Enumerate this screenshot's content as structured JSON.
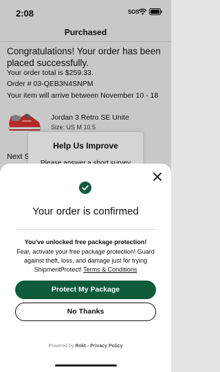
{
  "status_bar": {
    "time": "2:08",
    "sos": "SOS"
  },
  "header": {
    "title": "Purchased"
  },
  "order": {
    "congrats": "Congratulations!  Your order has been placed successfully.",
    "total_line": "Your order total is $259.33.",
    "order_number_line": "Order # 03-QEB3N4SNPM",
    "arrival_line": "Your item will arrive between  November 10 - 18"
  },
  "product": {
    "name": "Jordan 3 Retro SE Unite",
    "size": "Size: US M 10.5"
  },
  "next_section": {
    "label": "Next S"
  },
  "survey": {
    "title": "Help Us Improve",
    "subtitle": "Please answer a short survey"
  },
  "sheet": {
    "title": "Your order is confirmed",
    "offer_heading": "You've unlocked free package protection!",
    "offer_body": "Fear, activate your free package protection! Guard against theft, loss, and damage just for trying ShipmentProtect!",
    "terms_link": "Terms & Conditions",
    "primary_button": "Protect My Package",
    "secondary_button": "No Thanks",
    "powered_prefix": "Powered by",
    "powered_brand": "Rokt",
    "powered_suffix": " - Privacy Policy"
  },
  "colors": {
    "accent": "#0f5c3b"
  },
  "icons": [
    "wifi-icon",
    "battery-icon",
    "close-icon",
    "checkmark-icon",
    "sneaker-image"
  ]
}
